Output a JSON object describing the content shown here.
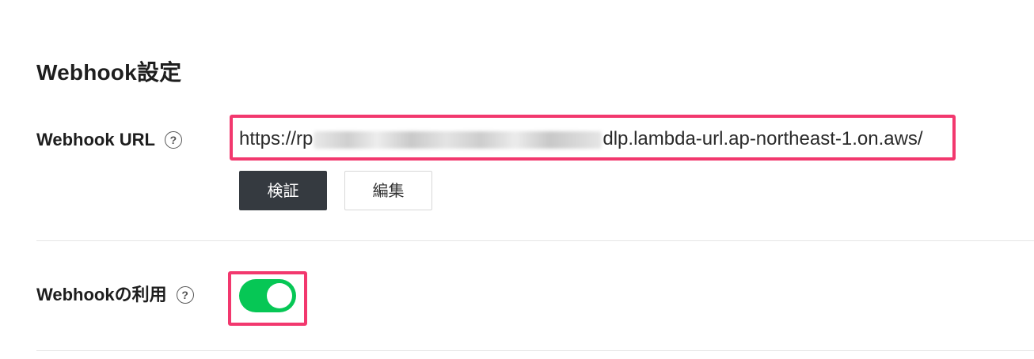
{
  "section": {
    "title": "Webhook設定"
  },
  "webhook_url": {
    "label": "Webhook URL",
    "help": "?",
    "value_prefix": "https://rp",
    "value_suffix": "dlp.lambda-url.ap-northeast-1.on.aws/"
  },
  "buttons": {
    "verify_label": "検証",
    "edit_label": "編集"
  },
  "webhook_use": {
    "label": "Webhookの利用",
    "help": "?",
    "enabled": true
  },
  "colors": {
    "highlight": "#f2386e",
    "toggle_on": "#06c755",
    "primary_button": "#353a40"
  }
}
